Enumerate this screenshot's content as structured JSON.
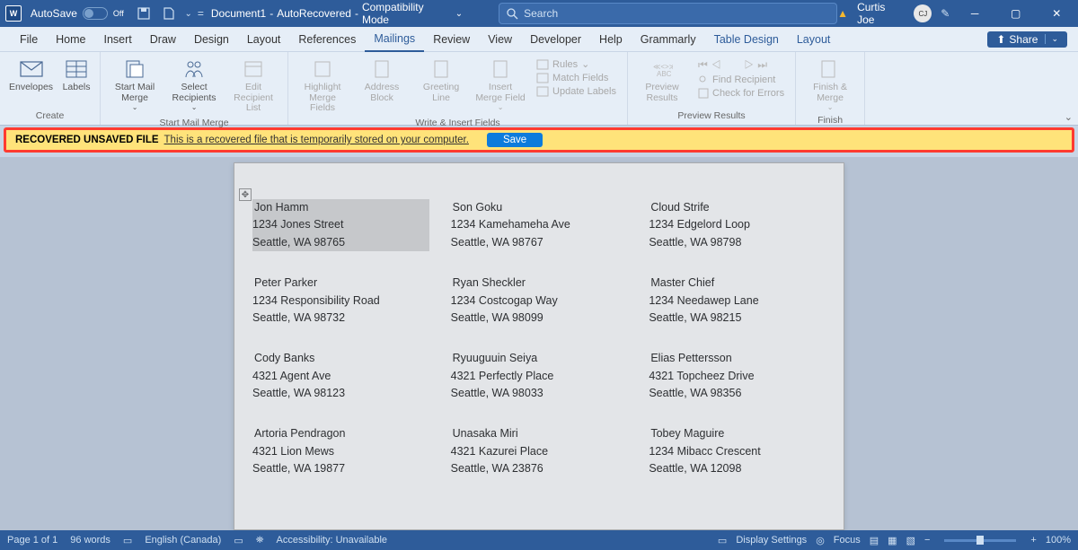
{
  "title_bar": {
    "autosave_label": "AutoSave",
    "autosave_state": "Off",
    "doc_name": "Document1",
    "doc_suffix1": "AutoRecovered",
    "doc_suffix2": "Compatibility Mode",
    "search_placeholder": "Search",
    "user_name": "Curtis Joe"
  },
  "tabs": [
    "File",
    "Home",
    "Insert",
    "Draw",
    "Design",
    "Layout",
    "References",
    "Mailings",
    "Review",
    "View",
    "Developer",
    "Help",
    "Grammarly",
    "Table Design",
    "Layout"
  ],
  "active_tab": "Mailings",
  "share_label": "Share",
  "ribbon": {
    "create": {
      "envelopes": "Envelopes",
      "labels": "Labels",
      "title": "Create"
    },
    "start": {
      "start_mail": "Start Mail Merge",
      "select_recip": "Select Recipients",
      "edit_recip": "Edit Recipient List",
      "title": "Start Mail Merge"
    },
    "write": {
      "highlight": "Highlight Merge Fields",
      "address": "Address Block",
      "greeting": "Greeting Line",
      "insert_field": "Insert Merge Field",
      "rules": "Rules",
      "match": "Match Fields",
      "update": "Update Labels",
      "title": "Write & Insert Fields"
    },
    "preview": {
      "preview": "Preview Results",
      "find": "Find Recipient",
      "check": "Check for Errors",
      "title": "Preview Results"
    },
    "finish": {
      "finish": "Finish & Merge",
      "title": "Finish"
    }
  },
  "message_bar": {
    "title": "RECOVERED UNSAVED FILE",
    "text": "This is a recovered file that is temporarily stored on your computer.",
    "button": "Save"
  },
  "addresses": [
    [
      {
        "name": "Jon Hamm",
        "street": "1234 Jones Street",
        "city": "Seattle, WA 98765",
        "hl": true
      },
      {
        "name": "Son Goku",
        "street": "1234 Kamehameha Ave",
        "city": "Seattle, WA 98767"
      },
      {
        "name": "Cloud Strife",
        "street": "1234 Edgelord Loop",
        "city": "Seattle, WA 98798"
      }
    ],
    [
      {
        "name": "Peter Parker",
        "street": "1234 Responsibility Road",
        "city": "Seattle, WA 98732"
      },
      {
        "name": "Ryan Sheckler",
        "street": "1234 Costcogap Way",
        "city": "Seattle, WA 98099"
      },
      {
        "name": "Master Chief",
        "street": "1234 Needawep Lane",
        "city": "Seattle, WA 98215"
      }
    ],
    [
      {
        "name": "Cody Banks",
        "street": "4321 Agent Ave",
        "city": "Seattle, WA 98123"
      },
      {
        "name": "Ryuuguuin Seiya",
        "street": "4321 Perfectly Place",
        "city": "Seattle, WA 98033"
      },
      {
        "name": "Elias Pettersson",
        "street": "4321 Topcheez Drive",
        "city": "Seattle, WA 98356"
      }
    ],
    [
      {
        "name": "Artoria Pendragon",
        "street": "4321 Lion Mews",
        "city": "Seattle, WA 19877"
      },
      {
        "name": "Unasaka Miri",
        "street": "4321 Kazurei Place",
        "city": "Seattle, WA 23876"
      },
      {
        "name": "Tobey Maguire",
        "street": "1234 Mibacc Crescent",
        "city": "Seattle, WA 12098"
      }
    ]
  ],
  "status": {
    "page": "Page 1 of 1",
    "words": "96 words",
    "lang": "English (Canada)",
    "access": "Accessibility: Unavailable",
    "display": "Display Settings",
    "focus": "Focus",
    "zoom": "100%"
  }
}
